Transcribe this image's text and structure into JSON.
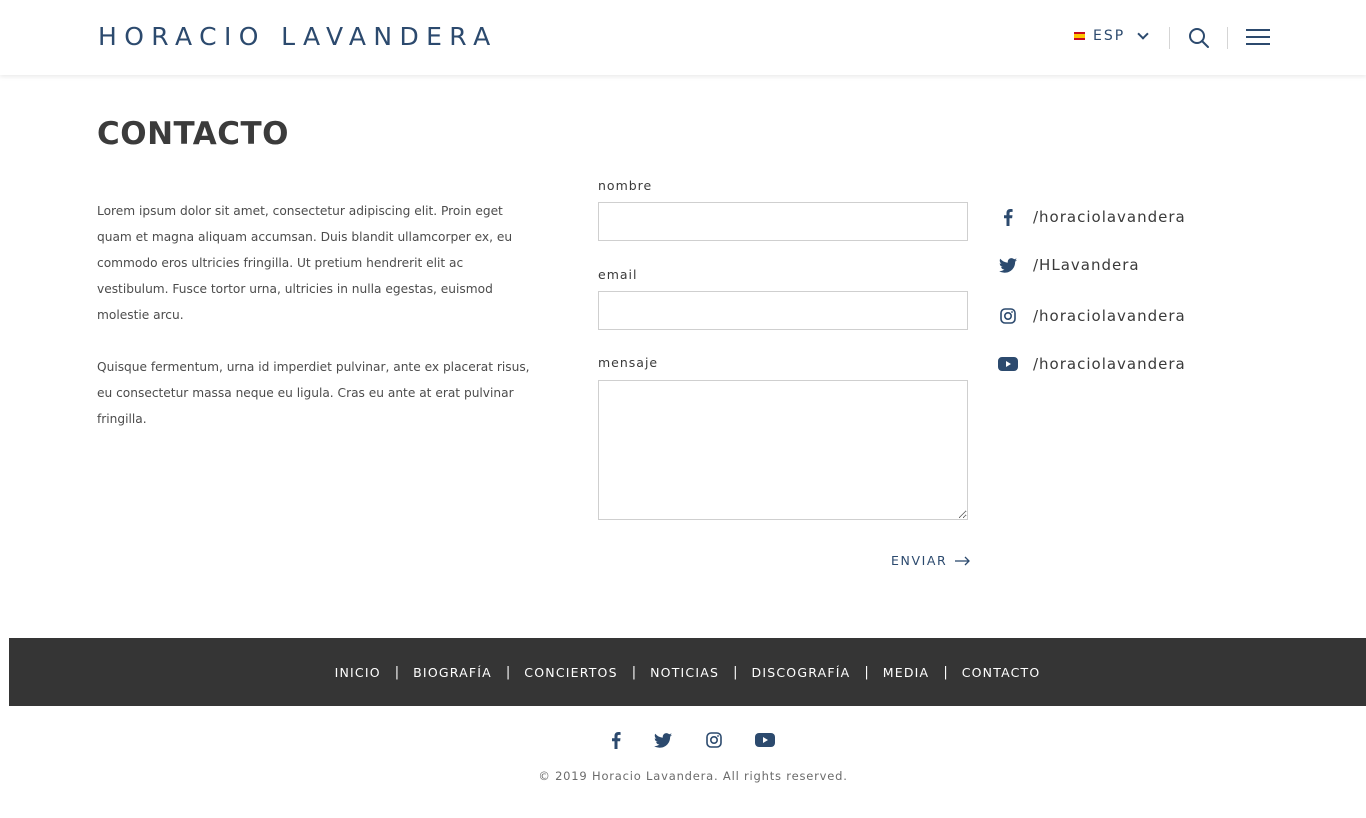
{
  "header": {
    "logo": "HORACIO LAVANDERA",
    "language": "ESP"
  },
  "page": {
    "title": "CONTACTO",
    "intro": [
      "Lorem ipsum dolor sit amet, consectetur adipiscing elit. Proin eget quam et magna aliquam accumsan. Duis blandit ullamcorper ex, eu commodo eros ultricies fringilla. Ut pretium hendrerit elit ac vestibulum. Fusce tortor urna, ultricies in nulla egestas, euismod molestie arcu.",
      "Quisque fermentum, urna id imperdiet pulvinar, ante ex placerat risus, eu consectetur massa neque eu ligula. Cras eu ante at erat pulvinar fringilla."
    ]
  },
  "form": {
    "name_label": "nombre",
    "name_value": "",
    "email_label": "email",
    "email_value": "",
    "message_label": "mensaje",
    "message_value": "",
    "submit_label": "ENVIAR"
  },
  "social": [
    {
      "icon": "facebook-icon",
      "handle": "/horaciolavandera"
    },
    {
      "icon": "twitter-icon",
      "handle": "/HLavandera"
    },
    {
      "icon": "instagram-icon",
      "handle": "/horaciolavandera"
    },
    {
      "icon": "youtube-icon",
      "handle": "/horaciolavandera"
    }
  ],
  "footer": {
    "nav": [
      "INICIO",
      "BIOGRAFÍA",
      "CONCIERTOS",
      "NOTICIAS",
      "DISCOGRAFÍA",
      "MEDIA",
      "CONTACTO"
    ],
    "separator": "|",
    "copyright": "© 2019 Horacio Lavandera. All rights reserved."
  },
  "colors": {
    "brand": "#2c4a6e",
    "footer_bg": "#353535",
    "flag_red": "#c60b1e",
    "flag_yellow": "#ffc400"
  }
}
